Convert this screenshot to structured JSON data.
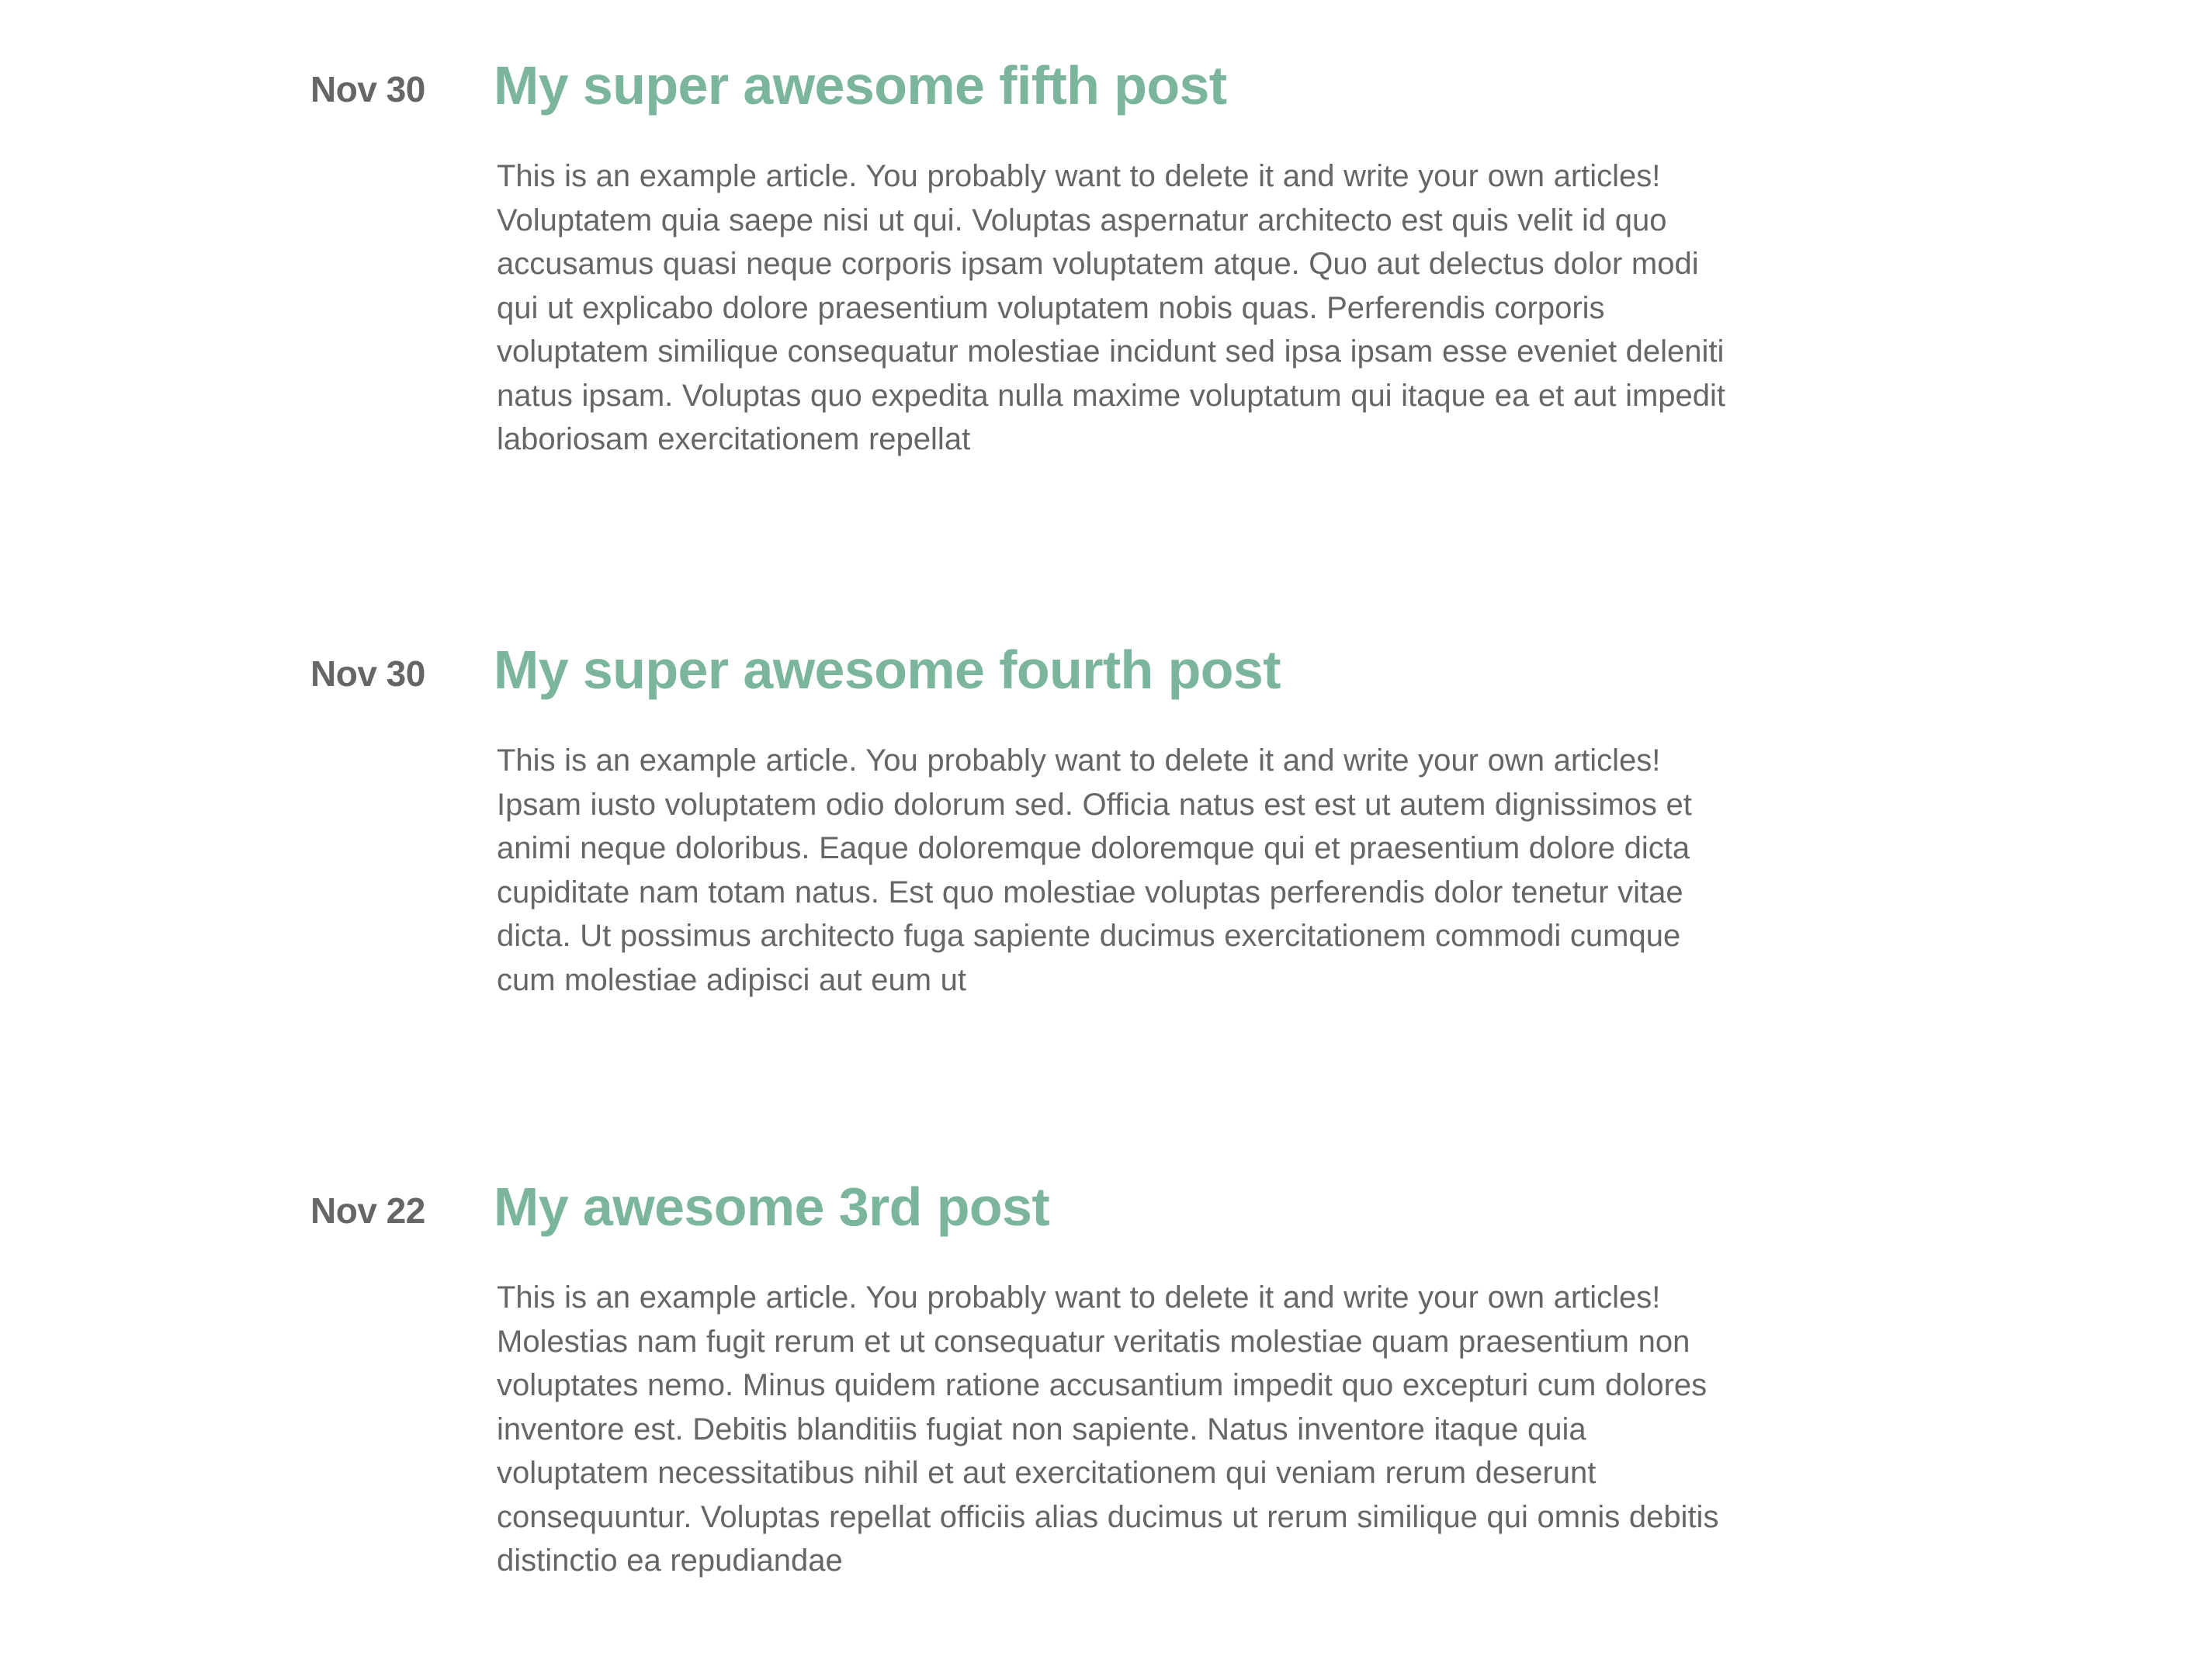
{
  "posts": [
    {
      "date": "Nov 30",
      "title": "My super awesome fifth post",
      "intro": "This is an example article. You probably want to delete it and write your own articles!",
      "body": "Voluptatem quia saepe nisi ut qui. Voluptas aspernatur architecto est quis velit id quo accusamus quasi neque corporis ipsam voluptatem atque. Quo aut delectus dolor modi qui ut explicabo dolore praesentium voluptatem nobis quas. Perferendis corporis voluptatem similique consequatur molestiae incidunt sed ipsa ipsam esse eveniet deleniti natus ipsam. Voluptas quo expedita nulla maxime voluptatum qui itaque ea et aut impedit laboriosam exercitationem repellat"
    },
    {
      "date": "Nov 30",
      "title": "My super awesome fourth post",
      "intro": "This is an example article. You probably want to delete it and write your own articles!",
      "body": "Ipsam iusto voluptatem odio dolorum sed. Officia natus est est ut autem dignissimos et animi neque doloribus. Eaque doloremque doloremque qui et praesentium dolore dicta cupiditate nam totam natus. Est quo molestiae voluptas perferendis dolor tenetur vitae dicta. Ut possimus architecto fuga sapiente ducimus exercitationem commodi cumque cum molestiae adipisci aut eum ut"
    },
    {
      "date": "Nov 22",
      "title": "My awesome 3rd post",
      "text": "This is an example article. You probably want to delete it and write your own articles! Molestias nam fugit rerum et ut consequatur veritatis molestiae quam praesentium non voluptates nemo. Minus quidem ratione accusantium impedit quo excepturi cum dolores inventore est. Debitis blanditiis fugiat non sapiente. Natus inventore itaque quia voluptatem necessitatibus nihil et aut exercitationem qui veniam rerum deserunt consequuntur. Voluptas repellat officiis alias ducimus ut rerum similique qui omnis debitis distinctio ea repudiandae"
    }
  ],
  "colors": {
    "title": "#7ab59c",
    "text": "#666666",
    "background": "#ffffff"
  }
}
